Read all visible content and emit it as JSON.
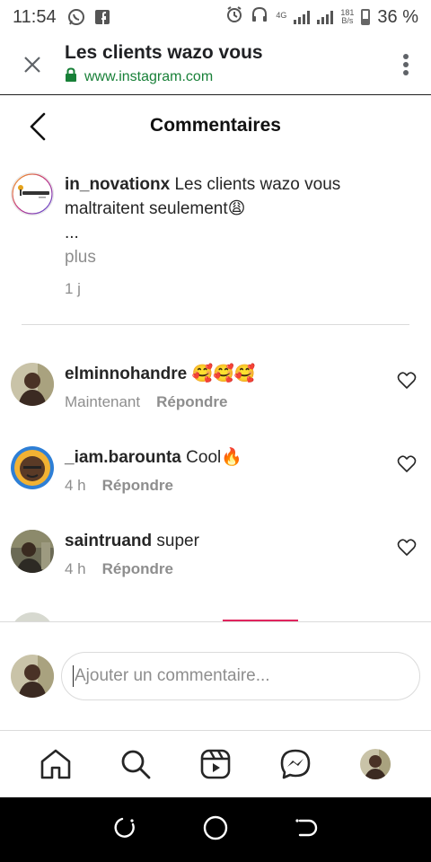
{
  "status_bar": {
    "time": "11:54",
    "network": "4G",
    "speed_value": "181",
    "speed_unit": "B/s",
    "battery": "36 %",
    "icons": [
      "whatsapp-icon",
      "facebook-icon",
      "alarm-icon",
      "headphones-icon",
      "signal-icon",
      "signal-icon",
      "battery-icon"
    ]
  },
  "browser": {
    "title": "Les clients wazo vous",
    "url": "www.instagram.com"
  },
  "header": {
    "title": "Commentaires"
  },
  "caption": {
    "username": "in_novationx",
    "text_line1": "Les clients wazo vous",
    "text_line2": "maltraitent seulement😩",
    "ellipsis": "...",
    "more": "plus",
    "time": "1 j"
  },
  "comments": [
    {
      "username": "elminnohandre",
      "text": "🥰🥰🥰",
      "time": "Maintenant",
      "reply": "Répondre"
    },
    {
      "username": "_iam.barounta",
      "text": "Cool🔥",
      "time": "4 h",
      "reply": "Répondre"
    },
    {
      "username": "saintruand",
      "text": "super",
      "time": "4 h",
      "reply": "Répondre"
    }
  ],
  "composer": {
    "placeholder": "Ajouter un commentaire..."
  },
  "colors": {
    "text": "#262626",
    "muted": "#8e8e8e",
    "url_green": "#188038",
    "divider": "#dbdbdb"
  }
}
